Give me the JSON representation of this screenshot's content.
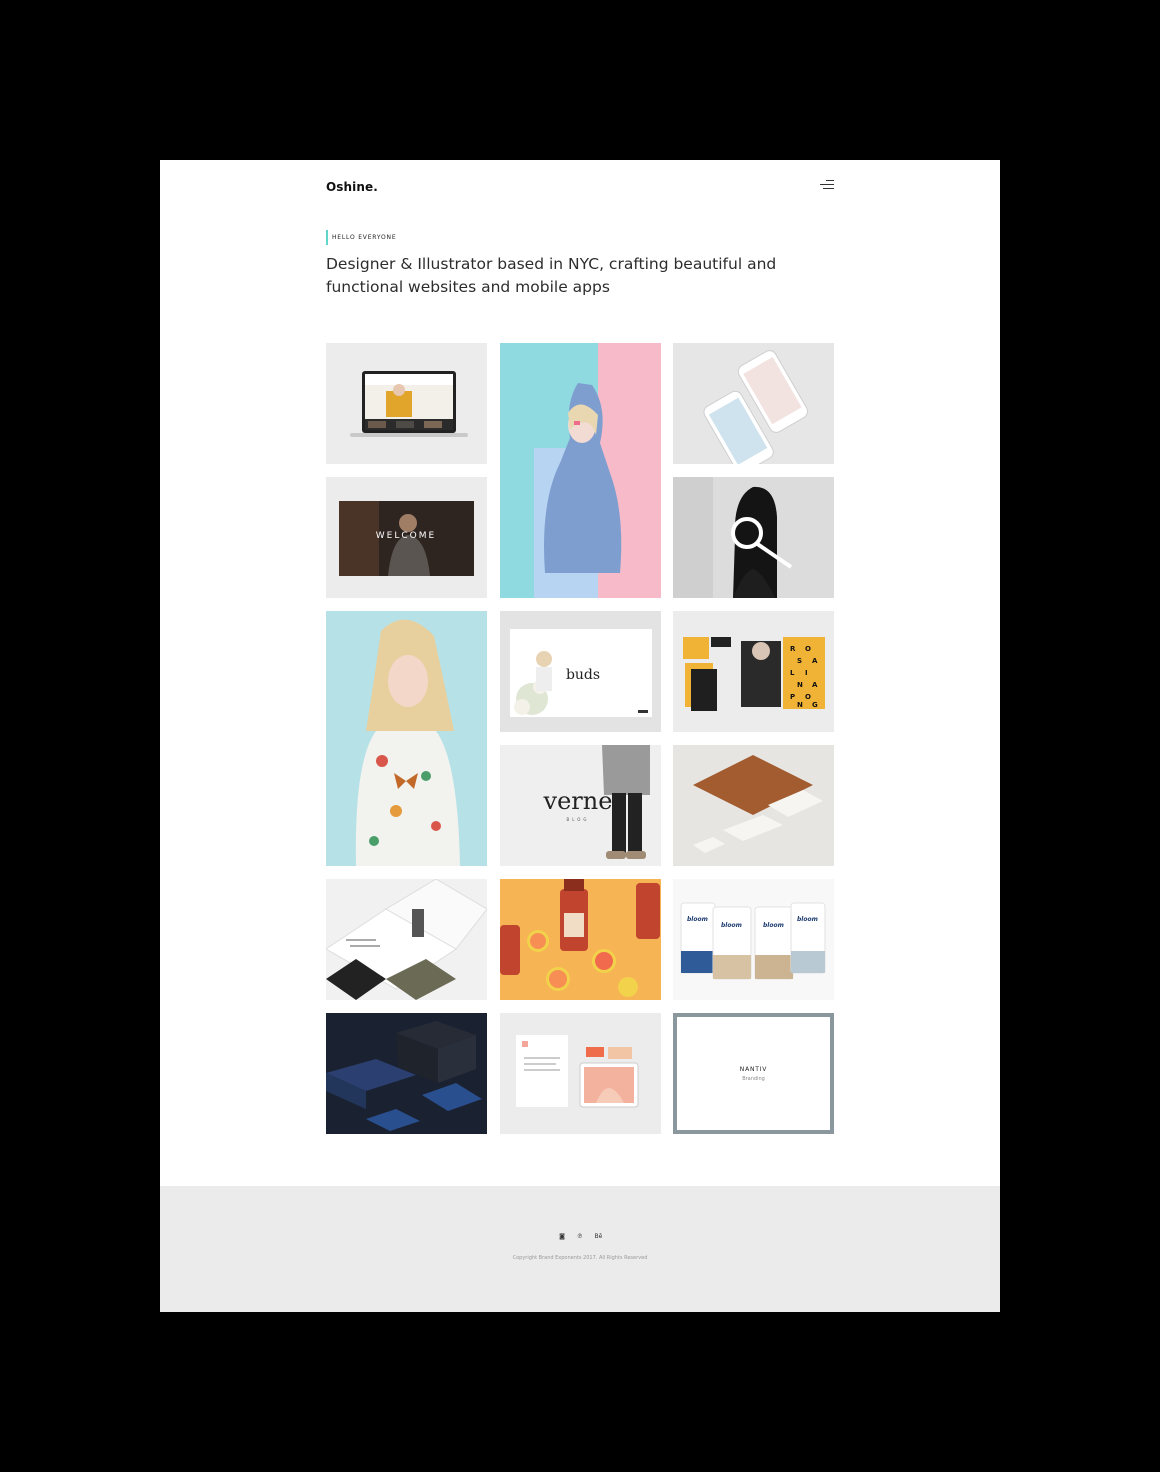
{
  "header": {
    "logo": "Oshine.",
    "menu_icon": "hamburger-icon"
  },
  "intro": {
    "eyebrow": "HELLO EVERYONE",
    "headline": "Designer & Illustrator based in NYC, crafting beautiful and functional websites and mobile apps",
    "accent_color": "#5fd6c9"
  },
  "portfolio": {
    "tiles": [
      {
        "name": "portfolio-tile-laptop-mockup"
      },
      {
        "name": "portfolio-tile-fashion-model-blue-pink"
      },
      {
        "name": "portfolio-tile-phone-mockups"
      },
      {
        "name": "portfolio-tile-welcome-website",
        "caption": "WELCOME"
      },
      {
        "name": "portfolio-tile-search-branding"
      },
      {
        "name": "portfolio-tile-floral-dress-portrait"
      },
      {
        "name": "portfolio-tile-buds-website",
        "caption": "buds"
      },
      {
        "name": "portfolio-tile-yellow-poster-branding",
        "letters": [
          "R",
          "O",
          "S",
          "A",
          "L",
          "I",
          "N",
          "A",
          "P",
          "O",
          "N",
          "G"
        ]
      },
      {
        "name": "portfolio-tile-verne-blog",
        "caption": "verne",
        "subcaption": "BLOG"
      },
      {
        "name": "portfolio-tile-stationery-brown"
      },
      {
        "name": "portfolio-tile-magazine-layout"
      },
      {
        "name": "portfolio-tile-juice-bottles"
      },
      {
        "name": "portfolio-tile-bloom-packaging",
        "caption": "bloom"
      },
      {
        "name": "portfolio-tile-navy-packaging"
      },
      {
        "name": "portfolio-tile-letterhead-stationery"
      },
      {
        "name": "portfolio-tile-nantiv-branding",
        "title": "NANTIV",
        "subtitle": "Branding"
      }
    ]
  },
  "footer": {
    "social": [
      {
        "icon": "instagram-icon",
        "glyph": "◙"
      },
      {
        "icon": "pinterest-icon",
        "glyph": "℗"
      },
      {
        "icon": "behance-icon",
        "glyph": "Bē"
      }
    ],
    "copyright": "Copyright Brand Exponents 2017. All Rights Reserved"
  }
}
